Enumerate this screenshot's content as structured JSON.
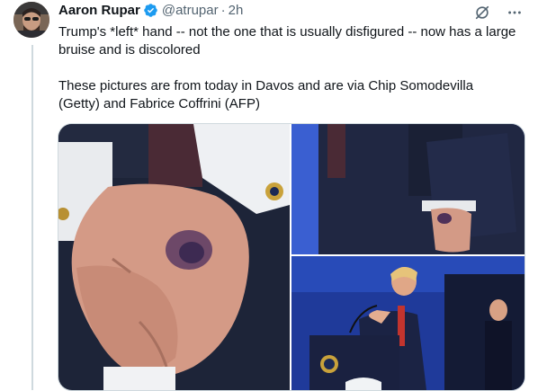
{
  "tweet": {
    "author_name": "Aaron Rupar",
    "handle": "@atrupar",
    "separator": "·",
    "time": "2h",
    "paragraphs": [
      "Trump's *left* hand -- not the one that is usually disfigured -- now has a large bruise and is discolored",
      "These pictures are from today in Davos and are via Chip Somodevilla (Getty) and Fabrice Coffrini (AFP)"
    ],
    "icons": {
      "verified": "verified-badge-icon",
      "grok": "grok-icon",
      "more": "more-icon"
    },
    "colors": {
      "verified": "#1d9bf0",
      "secondary_text": "#536471",
      "thread_line": "#cfd9de"
    },
    "media": [
      {
        "name": "bruised-hand-closeup"
      },
      {
        "name": "hand-at-side"
      },
      {
        "name": "speaker-at-podium"
      }
    ]
  }
}
